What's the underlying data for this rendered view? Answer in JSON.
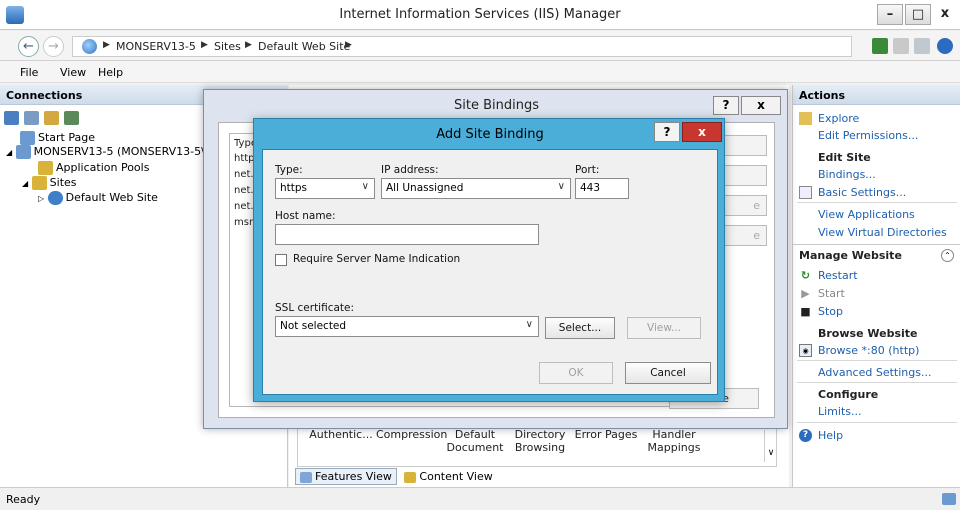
{
  "window": {
    "title": "Internet Information Services (IIS) Manager",
    "min": "–",
    "max": "□",
    "close": "x"
  },
  "address": {
    "back": "←",
    "forward": "→",
    "crumbs": [
      "MONSERV13-5",
      "Sites",
      "Default Web Site"
    ],
    "sep": "▶"
  },
  "menu": {
    "file": "File",
    "view": "View",
    "help": "Help"
  },
  "connections": {
    "header": "Connections",
    "tree": {
      "start_page": "Start Page",
      "server": "MONSERV13-5 (MONSERV13-5\\",
      "app_pools": "Application Pools",
      "sites": "Sites",
      "default_site": "Default Web Site",
      "expand_open": "◢",
      "expand_closed": "▷"
    }
  },
  "center": {
    "features": [
      "Authentic...",
      "Compression",
      "Default Document",
      "Directory Browsing",
      "Error Pages",
      "Handler Mappings"
    ],
    "features_view": "Features View",
    "content_view": "Content View"
  },
  "actions": {
    "header": "Actions",
    "explore": "Explore",
    "edit_permissions": "Edit Permissions...",
    "edit_site": "Edit Site",
    "bindings": "Bindings...",
    "basic_settings": "Basic Settings...",
    "view_applications": "View Applications",
    "view_virtual_dirs": "View Virtual Directories",
    "manage_website": "Manage Website",
    "restart": "Restart",
    "start": "Start",
    "stop": "Stop",
    "browse_website": "Browse Website",
    "browse_80": "Browse *:80 (http)",
    "advanced_settings": "Advanced Settings...",
    "configure": "Configure",
    "limits": "Limits...",
    "help": "Help",
    "collapse": "⌃"
  },
  "status": {
    "text": "Ready"
  },
  "site_bindings": {
    "title": "Site Bindings",
    "help": "?",
    "close": "x",
    "column_type": "Type",
    "rows": [
      "http",
      "net.tc",
      "net.p",
      "net.m",
      "msm"
    ],
    "close_button": "Close",
    "side_e1": "e",
    "side_e2": "e"
  },
  "add_binding": {
    "title": "Add Site Binding",
    "help": "?",
    "close": "x",
    "type_label": "Type:",
    "type_value": "https",
    "ip_label": "IP address:",
    "ip_value": "All Unassigned",
    "port_label": "Port:",
    "port_value": "443",
    "host_label": "Host name:",
    "host_value": "",
    "sni_label": "Require Server Name Indication",
    "sni_checked": false,
    "ssl_label": "SSL certificate:",
    "ssl_value": "Not selected",
    "select_button": "Select...",
    "view_button": "View...",
    "ok_button": "OK",
    "cancel_button": "Cancel",
    "dropdown_arrow": "∨"
  }
}
